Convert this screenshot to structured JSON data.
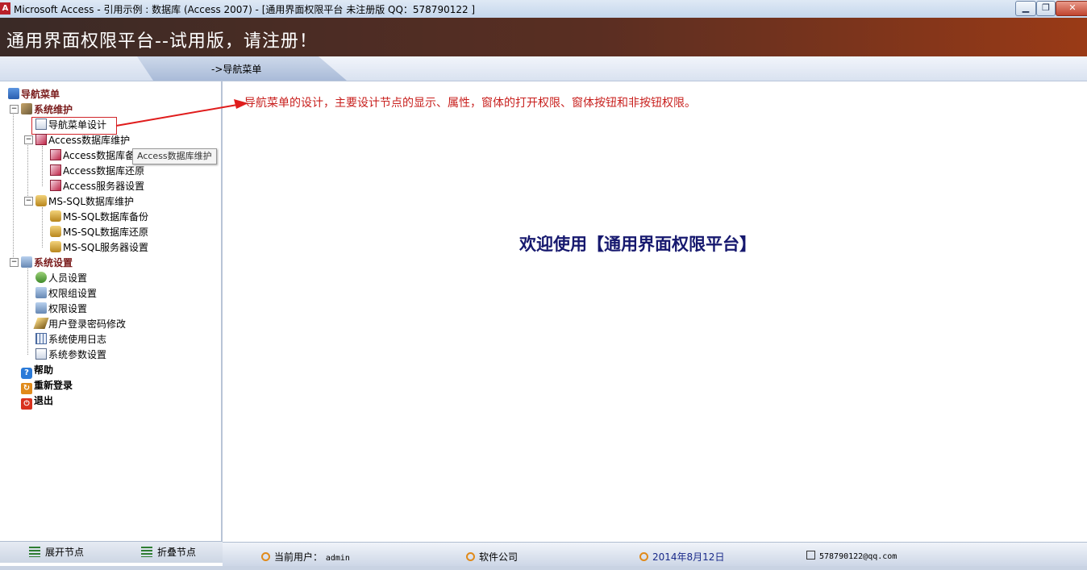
{
  "window": {
    "title": "Microsoft Access - 引用示例 : 数据库 (Access 2007) - [通用界面权限平台  未注册版 QQ：578790122 ]",
    "app_icon_letter": "A",
    "minimize": "▁",
    "maximize": "❐",
    "close": "✕"
  },
  "banner": {
    "title": "通用界面权限平台--试用版，请注册！"
  },
  "breadcrumb": {
    "text": "->导航菜单"
  },
  "tree": {
    "root": "导航菜单",
    "sys_maint": "系统维护",
    "nav_design": "导航菜单设计",
    "access_maint": "Access数据库维护",
    "access_backup": "Access数据库备份",
    "access_restore": "Access数据库还原",
    "access_server": "Access服务器设置",
    "mssql_maint": "MS-SQL数据库维护",
    "mssql_backup": "MS-SQL数据库备份",
    "mssql_restore": "MS-SQL数据库还原",
    "mssql_server": "MS-SQL服务器设置",
    "sys_settings": "系统设置",
    "user_settings": "人员设置",
    "group_settings": "权限组设置",
    "perm_settings": "权限设置",
    "pwd_change": "用户登录密码修改",
    "usage_log": "系统使用日志",
    "param_settings": "系统参数设置",
    "help": "帮助",
    "relogin": "重新登录",
    "exit": "退出",
    "expander_minus": "−"
  },
  "tooltip": {
    "text": "Access数据库维护"
  },
  "left_footer": {
    "expand": "展开节点",
    "collapse": "折叠节点"
  },
  "main": {
    "note": "导航菜单的设计，主要设计节点的显示、属性，窗体的打开权限、窗体按钮和非按钮权限。",
    "welcome": "欢迎使用【通用界面权限平台】"
  },
  "statusbar": {
    "current_user_label": "当前用户：",
    "current_user": "admin",
    "company": "软件公司",
    "date": "2014年8月12日",
    "email": "578790122@qq.com"
  },
  "colors": {
    "banner_start": "#3a2a26",
    "banner_end": "#9a3a16",
    "note": "#c8201e",
    "welcome": "#16186e",
    "arrow": "#e01c1c"
  }
}
